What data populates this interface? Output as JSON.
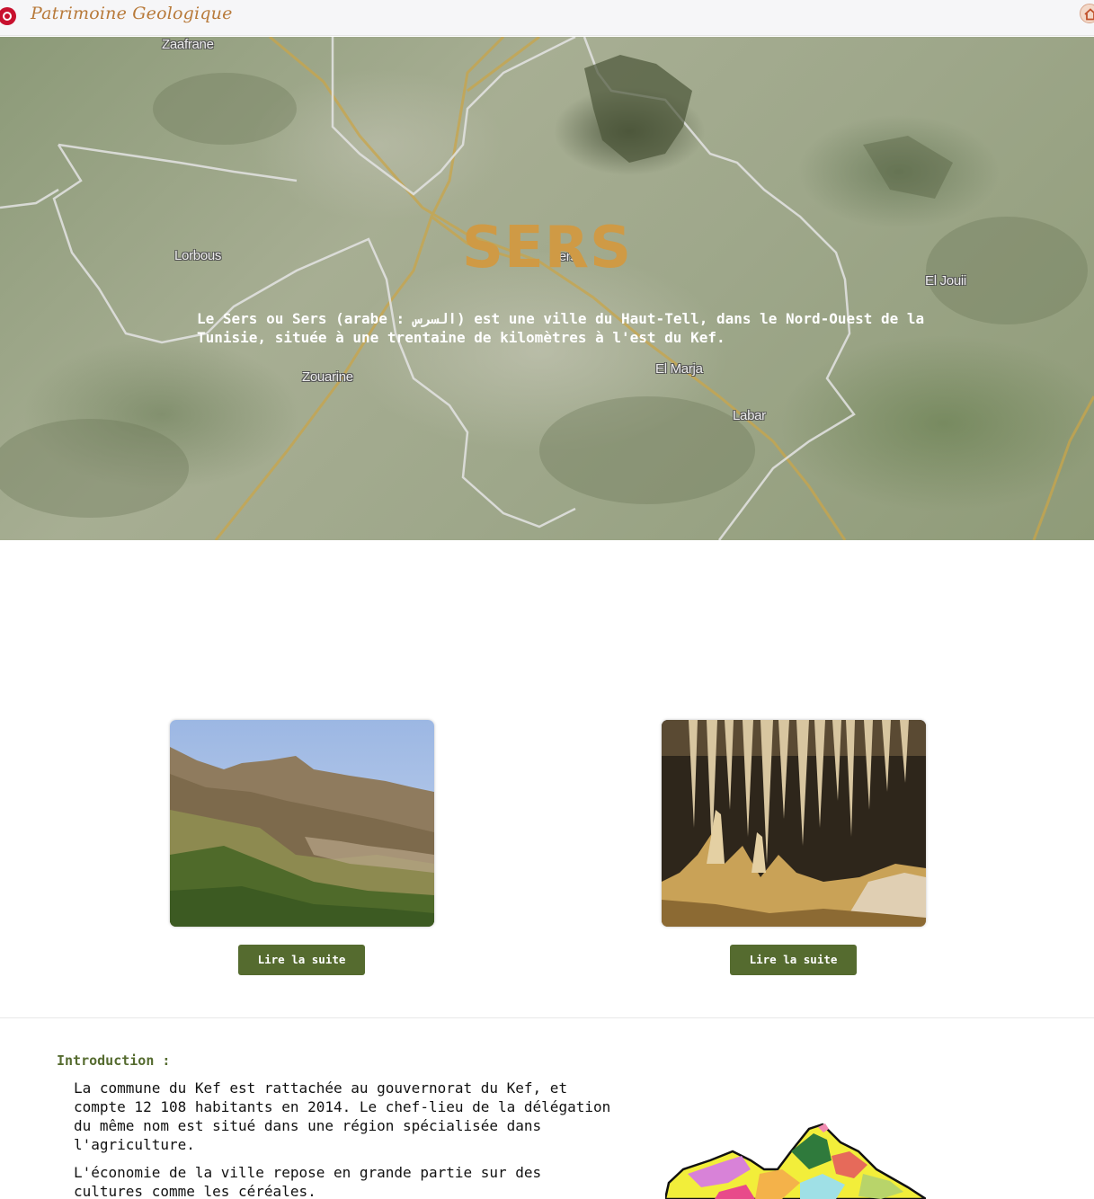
{
  "header": {
    "brand": "Patrimoine Geologique",
    "flag_icon": "tunisia-flag-icon",
    "home_icon": "home-icon"
  },
  "hero": {
    "title": "SERS",
    "description": "Le Sers ou Sers (arabe : السرس) est une ville du Haut-Tell, dans le Nord-Ouest de la Tunisie, située à une trentaine de kilomètres à l'est du Kef.",
    "map_labels": [
      "Zaafrane",
      "Lorbous",
      "Sers",
      "El Jouii",
      "Zouarine",
      "El Marja",
      "Labar"
    ]
  },
  "cards": [
    {
      "image": "mountain-landscape-photo",
      "button": "Lire la suite"
    },
    {
      "image": "cave-stalactites-photo",
      "button": "Lire la suite"
    }
  ],
  "intro": {
    "heading": "Introduction :",
    "paragraph1": "La commune du Kef est rattachée au gouvernorat du Kef, et compte 12 108 habitants en 2014. Le chef-lieu de la délégation du même nom est situé dans une région spécialisée dans l'agriculture.",
    "paragraph2": "L'économie de la ville repose en grande partie sur des cultures comme les céréales."
  },
  "colors": {
    "accent_green": "#556b2f",
    "title_gold": "#cf9a45",
    "brand_brown": "#b87a3a"
  }
}
